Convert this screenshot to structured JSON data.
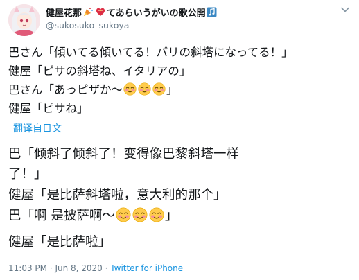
{
  "user": {
    "display_name": "健屋花那",
    "name_tail": "てあらいうがいの歌公開",
    "handle": "@sukosuko_sukoya"
  },
  "icons": [
    "party-popper-icon",
    "heart-ribbon-icon",
    "music-note-icon",
    "chevron-down-icon",
    "smiling-face-icon"
  ],
  "original": {
    "lines": [
      "巴さん「傾いてる傾いてる！パリの斜塔になってる！」",
      "健屋「ピサの斜塔ね、イタリアの」",
      "巴さん「あっピザか～",
      "」",
      "健屋「ピサね」"
    ]
  },
  "translate_label": "翻译自日文",
  "translation": {
    "lines": [
      "巴「倾斜了倾斜了！变得像巴黎斜塔一样",
      "了！」",
      "健屋「是比萨斜塔啦，意大利的那个」",
      "巴「啊 是披萨啊～",
      "」",
      "健屋「是比萨啦」"
    ]
  },
  "meta": {
    "time": "11:03 PM",
    "sep": " · ",
    "date": "Jun 8, 2020",
    "client": "Twitter for iPhone"
  },
  "colors": {
    "link": "#1b95e0",
    "muted": "#657786",
    "text": "#14171a"
  }
}
